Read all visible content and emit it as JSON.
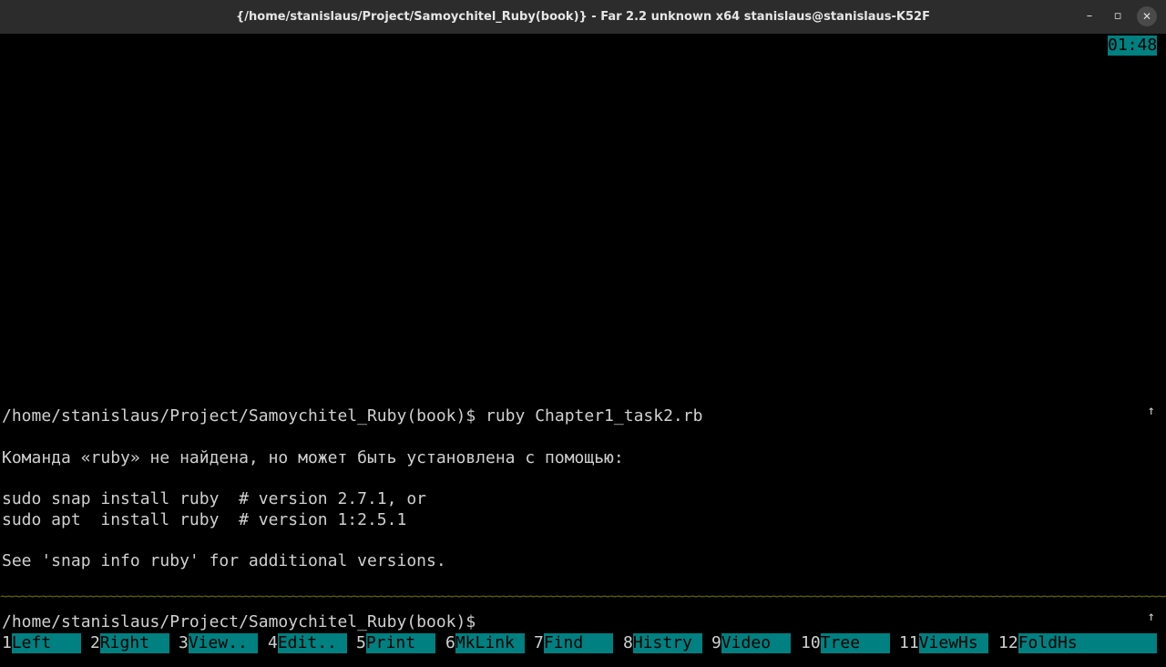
{
  "window": {
    "title": "{/home/stanislaus/Project/Samoychitel_Ruby(book)} - Far 2.2 unknown x64 stanislaus@stanislaus-K52F",
    "minimize_glyph": "–",
    "maximize_glyph": "▫",
    "close_glyph": "✕"
  },
  "terminal": {
    "clock": "01:48",
    "scroll_arrow": "↑",
    "lines": [
      "/home/stanislaus/Project/Samoychitel_Ruby(book)$ ruby Chapter1_task2.rb",
      "",
      "Команда «ruby» не найдена, но может быть установлена с помощью:",
      "",
      "sudo snap install ruby  # version 2.7.1, or",
      "sudo apt  install ruby  # version 1:2.5.1",
      "",
      "See 'snap info ruby' for additional versions."
    ],
    "separator": "~~~~~~~~~~~~~~~~~~~~~~~~~~~~~~~~~~~~~~~~~~~~~~~~~~~~~~~~~~~~~~~~~~~~~~~~~~~~~~~~~~~~~~~~~~~~~~~~~~~~~~~~~~~~~~~~~~~~~~~~~~~~~~~~~~~~~~~~~~~~~~~~~~~~~~~~~~~~~~~~~~~~~~~~~~~~~~~~~~~~~~~~~",
    "prompt": "/home/stanislaus/Project/Samoychitel_Ruby(book)$",
    "fkeys": [
      {
        "num": "1",
        "label": "Left"
      },
      {
        "num": "2",
        "label": "Right"
      },
      {
        "num": "3",
        "label": "View.."
      },
      {
        "num": "4",
        "label": "Edit.."
      },
      {
        "num": "5",
        "label": "Print"
      },
      {
        "num": "6",
        "label": "MkLink"
      },
      {
        "num": "7",
        "label": "Find"
      },
      {
        "num": "8",
        "label": "Histry"
      },
      {
        "num": "9",
        "label": "Video"
      },
      {
        "num": "10",
        "label": "Tree"
      },
      {
        "num": "11",
        "label": "ViewHs"
      },
      {
        "num": "12",
        "label": "FoldHs"
      }
    ]
  },
  "colors": {
    "terminal_bg": "#000000",
    "text": "#d0d0d0",
    "keybar_bg": "#008080",
    "separator": "#6f6f00",
    "titlebar_bg": "#2c2c2c"
  }
}
